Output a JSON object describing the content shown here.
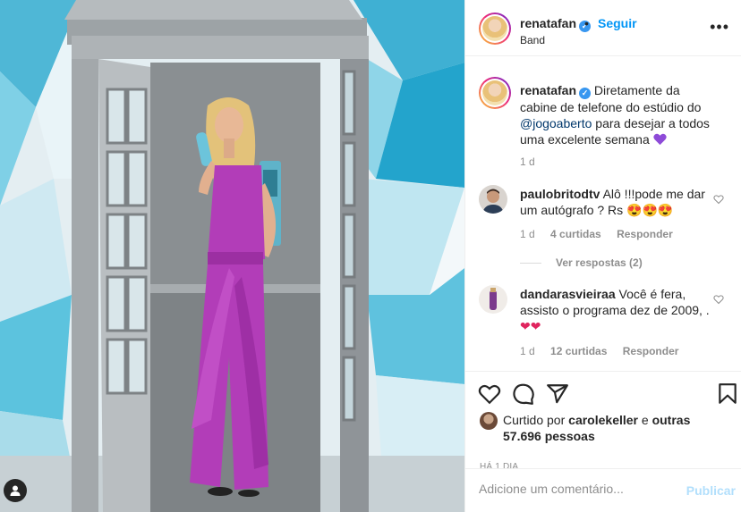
{
  "post": {
    "username": "renatafan",
    "verified": true,
    "separator": "•",
    "follow_label": "Seguir",
    "location": "Band",
    "more_icon": "more-horizontal-icon"
  },
  "caption": {
    "username": "renatafan",
    "text_before": "Diretamente da cabine de telefone do estúdio do ",
    "mention": "@jogoaberto",
    "text_after": " para desejar a todos uma excelente semana ",
    "emoji": "purple-heart-emoji",
    "time": "1 d"
  },
  "comments": [
    {
      "username": "paulobritodtv",
      "text": "Alô !!!pode me dar um autógrafo ? Rs ",
      "emojis": [
        "heart-eyes-emoji",
        "heart-eyes-emoji",
        "heart-eyes-emoji"
      ],
      "time": "1 d",
      "likes": "4 curtidas",
      "reply_label": "Responder",
      "view_replies": "Ver respostas (2)"
    },
    {
      "username": "dandarasvieiraa",
      "text": "Você é fera, assisto o programa dez de 2009, .",
      "emojis": [
        "red-heart-emoji",
        "red-heart-emoji"
      ],
      "time": "1 d",
      "likes": "12 curtidas",
      "reply_label": "Responder"
    }
  ],
  "actions": {
    "icons": [
      "heart-icon",
      "comment-icon",
      "share-icon",
      "bookmark-icon"
    ],
    "liked_prefix": "Curtido por ",
    "liked_user": "carolekeller",
    "liked_mid": " e ",
    "liked_others": "outras 57.696 pessoas",
    "date": "HÁ 1 DIA"
  },
  "add_comment": {
    "placeholder": "Adicione um comentário...",
    "publish_label": "Publicar"
  },
  "colors": {
    "accent_blue": "#0095f6",
    "link_blue": "#00376b",
    "muted": "#8e8e8e",
    "publish_disabled": "#b2dffc",
    "dress_purple": "#b23db8"
  }
}
